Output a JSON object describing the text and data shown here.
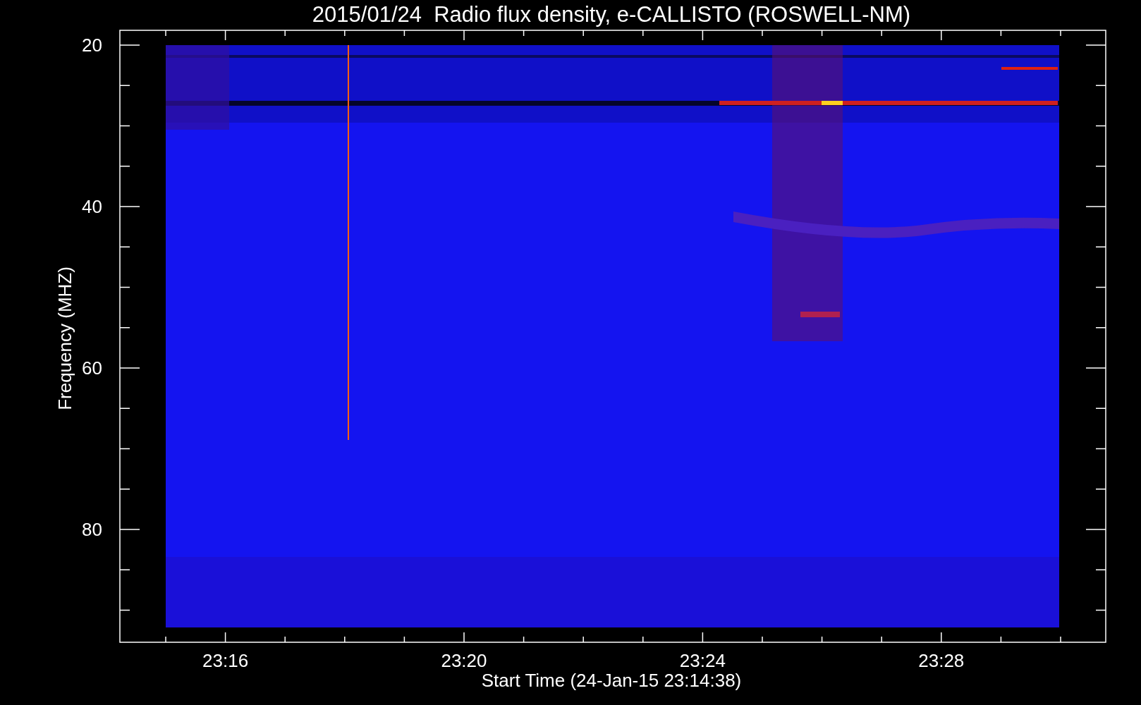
{
  "title": "2015/01/24  Radio flux density, e-CALLISTO (ROSWELL-NM)",
  "y_axis": {
    "label": "Frequency (MHZ)",
    "ticks": [
      "20",
      "40",
      "60",
      "80"
    ]
  },
  "x_axis": {
    "label": "Start Time (24-Jan-15 23:14:38)",
    "ticks": [
      "23:16",
      "23:20",
      "23:24",
      "23:28"
    ]
  }
}
